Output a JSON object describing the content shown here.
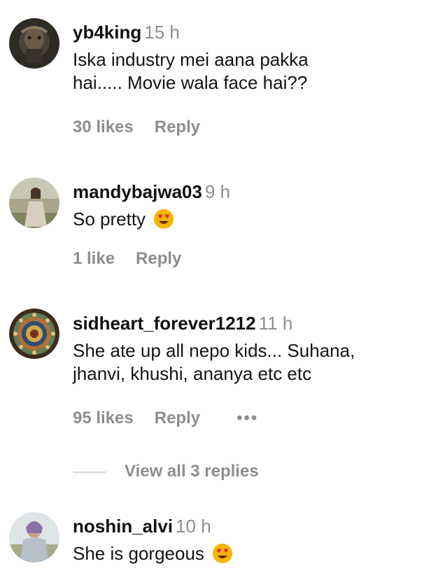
{
  "comments": [
    {
      "username": "yb4king",
      "time": "15 h",
      "text_lines": [
        "Iska industry mei aana pakka",
        "hai..... Movie wala face hai??"
      ],
      "likes": "30 likes",
      "reply": "Reply",
      "emoji": false
    },
    {
      "username": "mandybajwa03",
      "time": "9 h",
      "text_lines": [
        "So pretty"
      ],
      "likes": "1 like",
      "reply": "Reply",
      "emoji": true
    },
    {
      "username": "sidheart_forever1212",
      "time": "11 h",
      "text_lines": [
        "She ate up all nepo kids... Suhana,",
        "jhanvi, khushi, ananya etc etc"
      ],
      "likes": "95 likes",
      "reply": "Reply",
      "more": "•••",
      "emoji": false
    },
    {
      "username": "noshin_alvi",
      "time": "10 h",
      "text_lines": [
        "She is gorgeous"
      ],
      "emoji": true
    }
  ],
  "view_replies": "View all 3 replies",
  "colors": {
    "muted": "#8e8e8e",
    "text": "#141414",
    "emoji": "#f5b400",
    "heart": "#e8253c"
  },
  "icons": {
    "emoji": "heart-eyes-emoji-icon",
    "more": "more-options-icon"
  }
}
